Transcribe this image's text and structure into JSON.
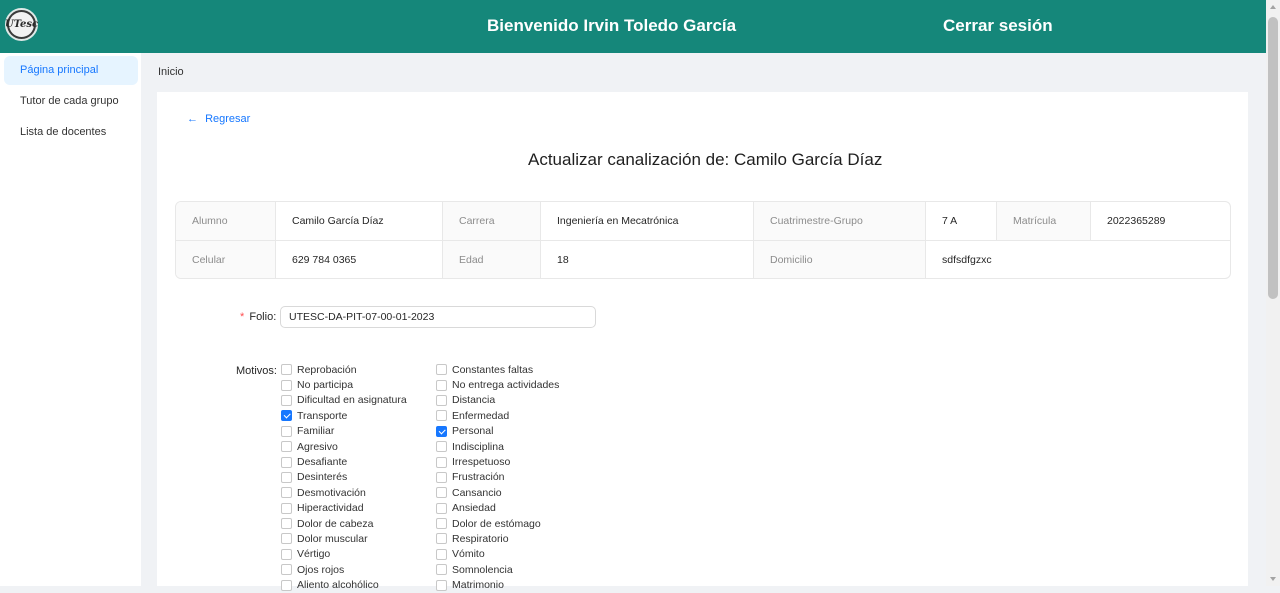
{
  "header": {
    "logo_text": "UTesc",
    "welcome": "Bienvenido Irvin Toledo García",
    "logout": "Cerrar sesión",
    "color": "#15877a"
  },
  "sidebar": {
    "items": [
      {
        "label": "Página principal",
        "active": true
      },
      {
        "label": "Tutor de cada grupo",
        "active": false
      },
      {
        "label": "Lista de docentes",
        "active": false
      }
    ]
  },
  "breadcrumb": "Inicio",
  "back": {
    "icon": "arrow-left-icon",
    "arrow": "←",
    "label": "Regresar"
  },
  "title": "Actualizar canalización de: Camilo García Díaz",
  "student": {
    "row1": [
      {
        "label": "Alumno",
        "value": "Camilo García Díaz"
      },
      {
        "label": "Carrera",
        "value": "Ingeniería en Mecatrónica"
      },
      {
        "label": "Cuatrimestre-Grupo",
        "value": "7 A"
      },
      {
        "label": "Matrícula",
        "value": "2022365289"
      }
    ],
    "row2": [
      {
        "label": "Celular",
        "value": "629 784 0365"
      },
      {
        "label": "Edad",
        "value": "18"
      },
      {
        "label": "Domicilio",
        "value": "sdfsdfgzxc"
      }
    ]
  },
  "form": {
    "folio_label": "Folio",
    "folio_required": "*",
    "folio_value": "UTESC-DA-PIT-07-00-01-2023",
    "motivos_label": "Motivos",
    "colon": ":",
    "motivos_col1": [
      {
        "label": "Reprobación",
        "checked": false
      },
      {
        "label": "No participa",
        "checked": false
      },
      {
        "label": "Dificultad en asignatura",
        "checked": false
      },
      {
        "label": "Transporte",
        "checked": true
      },
      {
        "label": "Familiar",
        "checked": false
      },
      {
        "label": "Agresivo",
        "checked": false
      },
      {
        "label": "Desafiante",
        "checked": false
      },
      {
        "label": "Desinterés",
        "checked": false
      },
      {
        "label": "Desmotivación",
        "checked": false
      },
      {
        "label": "Hiperactividad",
        "checked": false
      },
      {
        "label": "Dolor de cabeza",
        "checked": false
      },
      {
        "label": "Dolor muscular",
        "checked": false
      },
      {
        "label": "Vértigo",
        "checked": false
      },
      {
        "label": "Ojos rojos",
        "checked": false
      },
      {
        "label": "Aliento alcohólico",
        "checked": false
      }
    ],
    "motivos_col2": [
      {
        "label": "Constantes faltas",
        "checked": false
      },
      {
        "label": "No entrega actividades",
        "checked": false
      },
      {
        "label": "Distancia",
        "checked": false
      },
      {
        "label": "Enfermedad",
        "checked": false
      },
      {
        "label": "Personal",
        "checked": true
      },
      {
        "label": "Indisciplina",
        "checked": false
      },
      {
        "label": "Irrespetuoso",
        "checked": false
      },
      {
        "label": "Frustración",
        "checked": false
      },
      {
        "label": "Cansancio",
        "checked": false
      },
      {
        "label": "Ansiedad",
        "checked": false
      },
      {
        "label": "Dolor de estómago",
        "checked": false
      },
      {
        "label": "Respiratorio",
        "checked": false
      },
      {
        "label": "Vómito",
        "checked": false
      },
      {
        "label": "Somnolencia",
        "checked": false
      },
      {
        "label": "Matrimonio",
        "checked": false
      }
    ]
  }
}
